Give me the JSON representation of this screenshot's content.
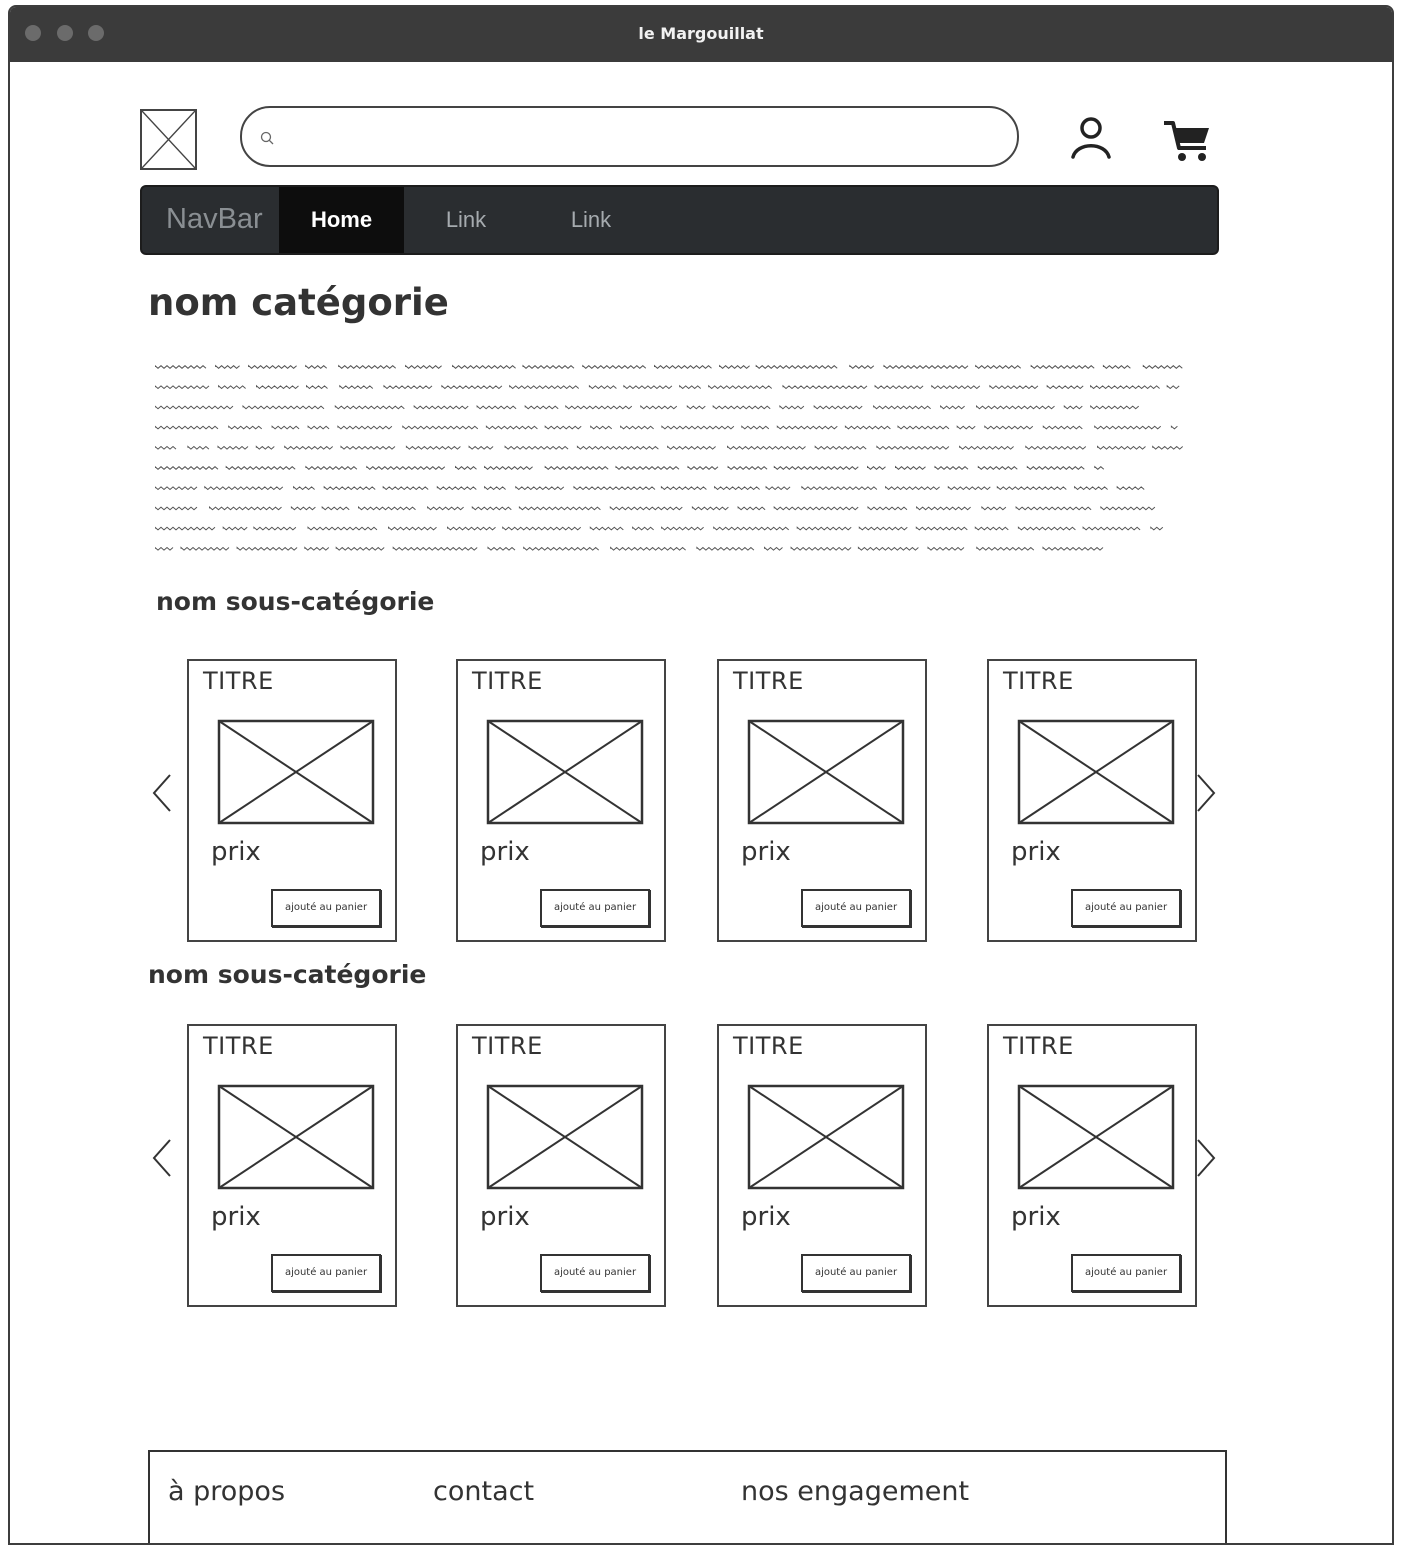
{
  "window": {
    "title": "le Margouillat"
  },
  "header": {
    "search_placeholder": "",
    "search_value": ""
  },
  "navbar": {
    "brand": "NavBar",
    "items": [
      {
        "label": "Home"
      },
      {
        "label": "Link"
      },
      {
        "label": "Link"
      }
    ]
  },
  "main": {
    "category_title": "nom catégorie",
    "sections": [
      {
        "title": "nom sous-catégorie",
        "products": [
          {
            "title": "TITRE",
            "price": "prix",
            "button": "ajouté au panier"
          },
          {
            "title": "TITRE",
            "price": "prix",
            "button": "ajouté au panier"
          },
          {
            "title": "TITRE",
            "price": "prix",
            "button": "ajouté au panier"
          },
          {
            "title": "TITRE",
            "price": "prix",
            "button": "ajouté au panier"
          }
        ]
      },
      {
        "title": "nom sous-catégorie",
        "products": [
          {
            "title": "TITRE",
            "price": "prix",
            "button": "ajouté au panier"
          },
          {
            "title": "TITRE",
            "price": "prix",
            "button": "ajouté au panier"
          },
          {
            "title": "TITRE",
            "price": "prix",
            "button": "ajouté au panier"
          },
          {
            "title": "TITRE",
            "price": "prix",
            "button": "ajouté au panier"
          }
        ]
      }
    ]
  },
  "footer": {
    "links": [
      {
        "label": "à propos"
      },
      {
        "label": "contact"
      },
      {
        "label": "nos engagement"
      }
    ]
  },
  "icons": [
    "logo-placeholder-icon",
    "search-icon",
    "user-icon",
    "cart-icon",
    "chevron-left-icon",
    "chevron-right-icon",
    "image-placeholder-icon"
  ]
}
